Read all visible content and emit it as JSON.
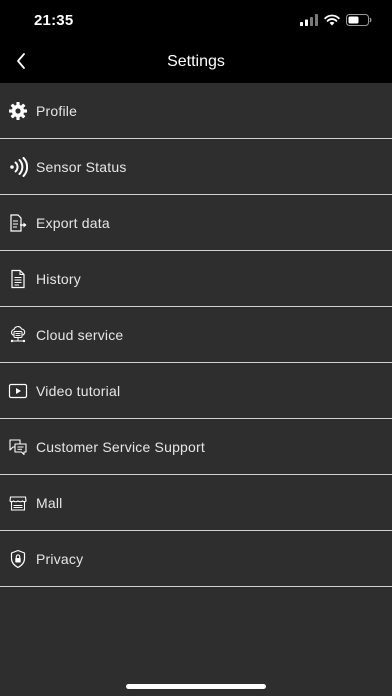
{
  "status_bar": {
    "time": "21:35",
    "icons": [
      "cellular-signal-icon",
      "wifi-icon",
      "battery-icon"
    ]
  },
  "nav": {
    "title": "Settings",
    "back_icon": "chevron-left-icon"
  },
  "menu": {
    "items": [
      {
        "id": "profile",
        "label": "Profile",
        "icon": "gear-icon"
      },
      {
        "id": "sensor-status",
        "label": "Sensor Status",
        "icon": "signal-waves-icon"
      },
      {
        "id": "export-data",
        "label": "Export data",
        "icon": "export-document-icon"
      },
      {
        "id": "history",
        "label": "History",
        "icon": "document-list-icon"
      },
      {
        "id": "cloud-service",
        "label": "Cloud service",
        "icon": "cloud-service-icon"
      },
      {
        "id": "video-tutorial",
        "label": "Video tutorial",
        "icon": "play-video-icon"
      },
      {
        "id": "customer-service-support",
        "label": "Customer Service Support",
        "icon": "chat-bubbles-icon"
      },
      {
        "id": "mall",
        "label": "Mall",
        "icon": "storefront-icon"
      },
      {
        "id": "privacy",
        "label": "Privacy",
        "icon": "shield-lock-icon"
      }
    ]
  },
  "colors": {
    "background": "#000000",
    "list_background": "#2e2e2e",
    "divider": "#cfcfcf",
    "text": "#e6e6e6"
  }
}
